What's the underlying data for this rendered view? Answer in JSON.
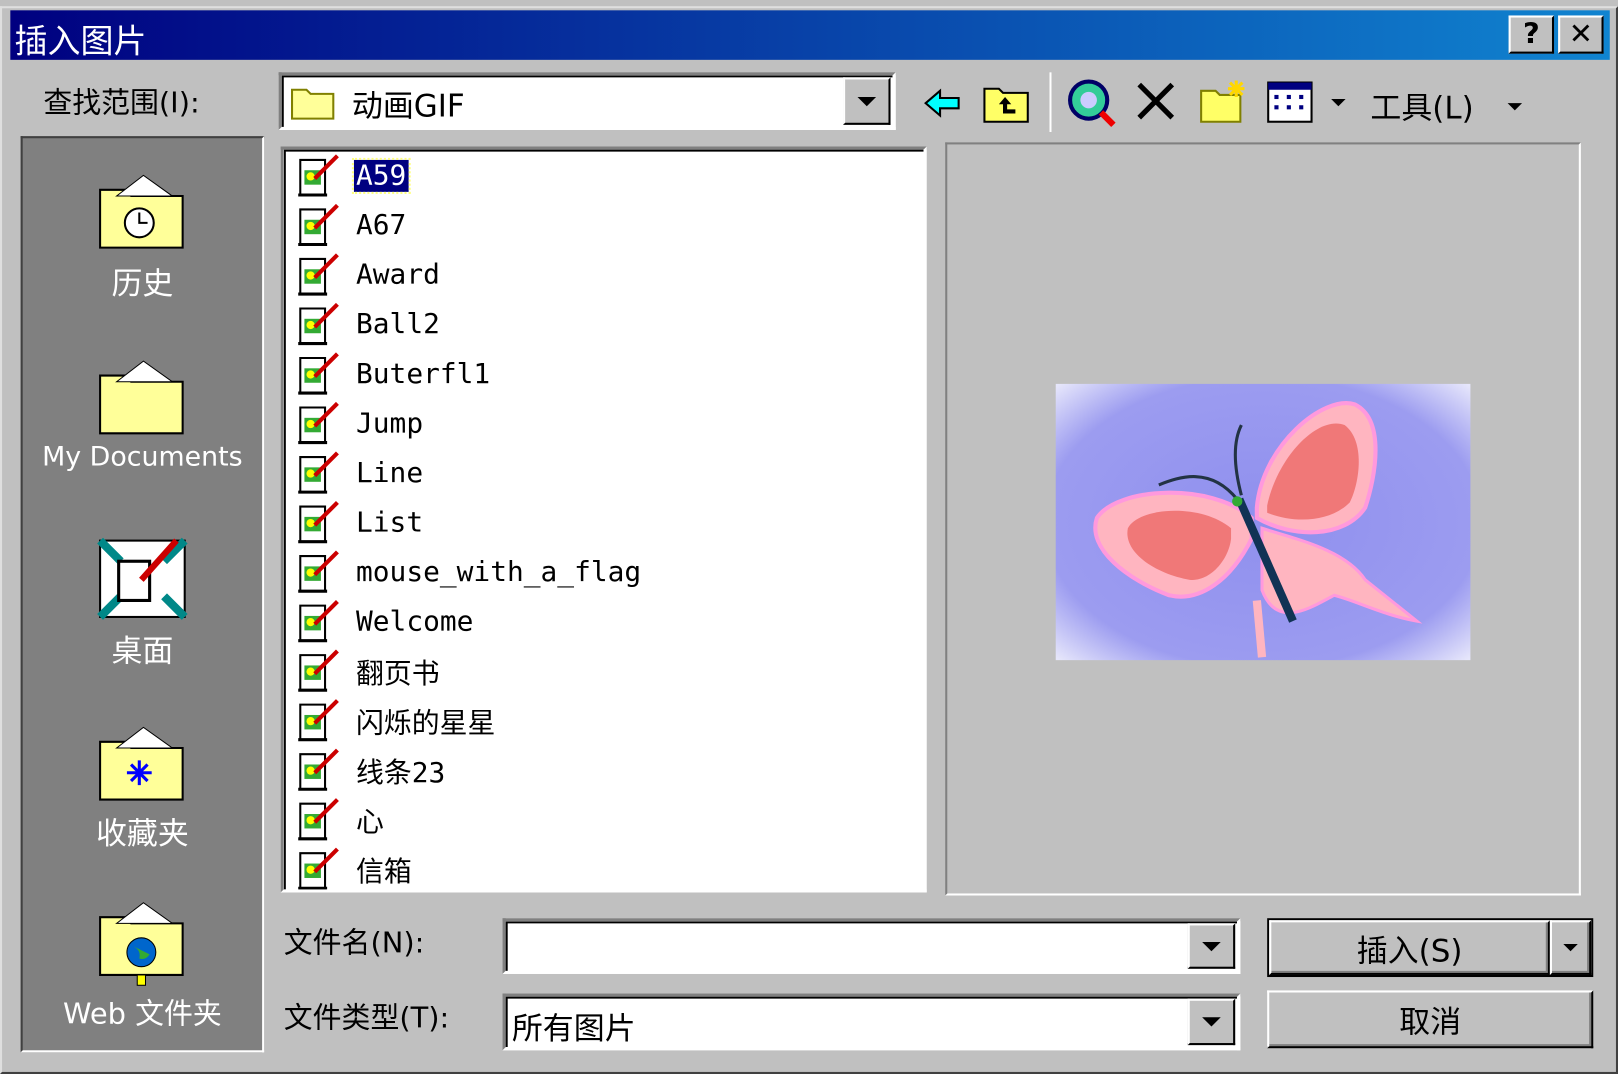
{
  "window": {
    "title": "插入图片",
    "help_label": "?",
    "close_label": "✕"
  },
  "toolbar": {
    "look_in_label": "查找范围(I):",
    "look_in_value": "动画GIF",
    "icons": [
      "back-arrow-icon",
      "up-folder-icon",
      "search-web-icon",
      "delete-icon",
      "new-folder-icon",
      "views-icon"
    ],
    "tools_label": "工具(L)"
  },
  "places": [
    {
      "label": "历史",
      "icon": "history-folder-icon"
    },
    {
      "label": "My Documents",
      "icon": "documents-folder-icon"
    },
    {
      "label": "桌面",
      "icon": "desktop-icon"
    },
    {
      "label": "收藏夹",
      "icon": "favorites-folder-icon"
    },
    {
      "label": "Web 文件夹",
      "icon": "web-folder-icon"
    }
  ],
  "files": [
    {
      "name": "A59",
      "selected": true
    },
    {
      "name": "A67"
    },
    {
      "name": "Award"
    },
    {
      "name": "Ball2"
    },
    {
      "name": "Buterfl1"
    },
    {
      "name": "Jump"
    },
    {
      "name": "Line"
    },
    {
      "name": "List"
    },
    {
      "name": "mouse_with_a_flag"
    },
    {
      "name": "Welcome"
    },
    {
      "name": "翻页书"
    },
    {
      "name": "闪烁的星星"
    },
    {
      "name": "线条23"
    },
    {
      "name": "心"
    },
    {
      "name": "信箱"
    }
  ],
  "form": {
    "filename_label": "文件名(N):",
    "filename_value": "",
    "filetype_label": "文件类型(T):",
    "filetype_value": "所有图片",
    "insert_label": "插入(S)",
    "cancel_label": "取消"
  },
  "colors": {
    "title_start": "#000080",
    "title_end": "#1084d0",
    "face": "#c0c0c0",
    "places_bg": "#808080",
    "selection": "#000080"
  }
}
